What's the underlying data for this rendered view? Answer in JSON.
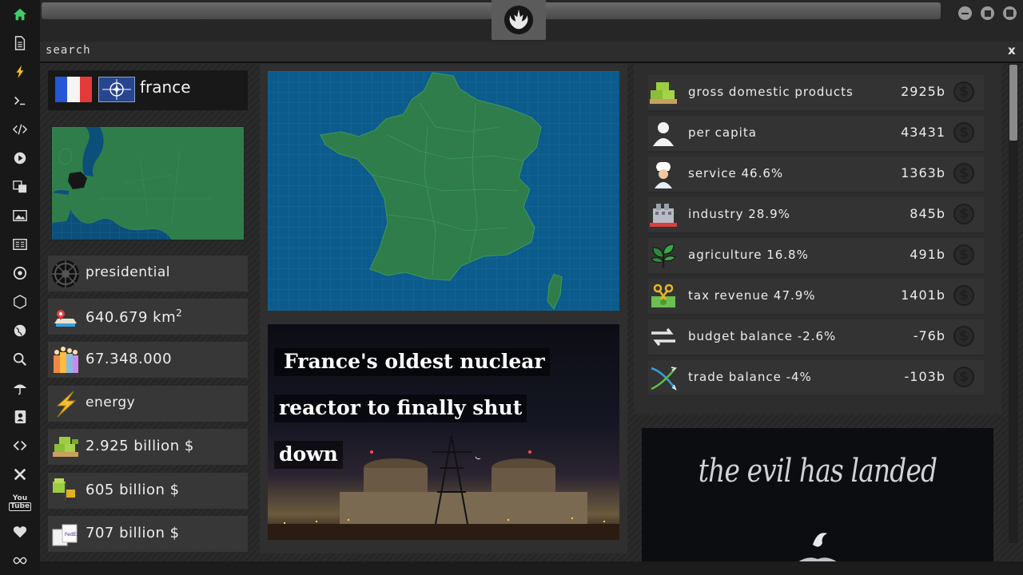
{
  "search": {
    "label": "search",
    "close": "x"
  },
  "country": {
    "name": "france"
  },
  "left_stats": [
    {
      "text": "presidential",
      "icon": "empire-icon"
    },
    {
      "text": "640.679 km",
      "sup": "2",
      "icon": "map-pin-icon"
    },
    {
      "text": "67.348.000",
      "icon": "population-icon"
    },
    {
      "text": "energy",
      "icon": "lightning-icon"
    },
    {
      "text": "2.925 billion $",
      "icon": "money-pallet-icon"
    },
    {
      "text": "605 billion $",
      "icon": "forklift-icon"
    },
    {
      "text": "707 billion $",
      "icon": "boxes-icon"
    }
  ],
  "news": {
    "lines": [
      "France's oldest nuclear",
      "reactor to finally shut",
      "down"
    ]
  },
  "economy": [
    {
      "label": "gross domestic products",
      "value": "2925b",
      "icon": "money-pallet-icon"
    },
    {
      "label": "per capita",
      "value": "43431",
      "icon": "person-icon"
    },
    {
      "label": "service 46.6%",
      "value": "1363b",
      "icon": "chef-icon"
    },
    {
      "label": "industry 28.9%",
      "value": "845b",
      "icon": "factory-icon"
    },
    {
      "label": "agriculture 16.8%",
      "value": "491b",
      "icon": "plant-icon"
    },
    {
      "label": "tax revenue 47.9%",
      "value": "1401b",
      "icon": "scissors-money-icon"
    },
    {
      "label": "budget balance -2.6%",
      "value": "-76b",
      "icon": "exchange-icon"
    },
    {
      "label": "trade balance -4%",
      "value": "-103b",
      "icon": "trade-icon"
    }
  ],
  "promo": {
    "text": "the evil has landed"
  },
  "colors": {
    "map_sea": "#0b5b8c",
    "land": "#2e7d4a",
    "accent": "#2ecc71"
  }
}
